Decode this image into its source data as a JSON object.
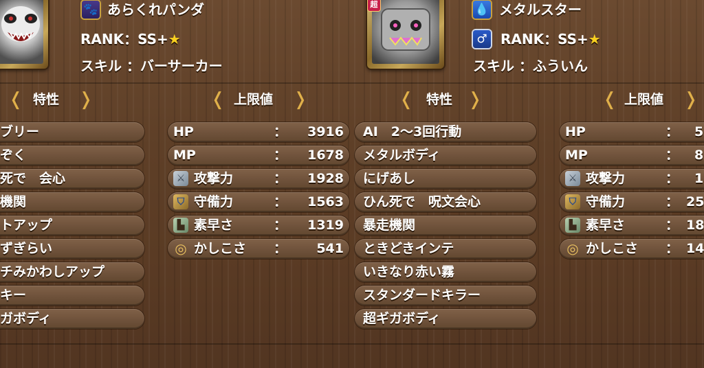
{
  "left_monster": {
    "name": "あらくれパンダ",
    "family_icon": "paw-icon",
    "rank_label": "RANK：SS+",
    "rank_star": "★",
    "skill_line": "スキル ：バーサーカー",
    "traits_header": "特性",
    "traits": [
      "ブリー",
      "ぞく",
      "死で　会心",
      "機関",
      "トアップ",
      "ずぎらい",
      "チみかわしアップ",
      "キー",
      "ガボディ"
    ],
    "stats_header": "上限値",
    "stats": [
      {
        "label": "HP",
        "sep": "：",
        "value": "3916",
        "icon": ""
      },
      {
        "label": "MP",
        "sep": "：",
        "value": "1678",
        "icon": ""
      },
      {
        "label": "攻撃力",
        "sep": "：",
        "value": "1928",
        "icon": "sword-icon"
      },
      {
        "label": "守備力",
        "sep": "：",
        "value": "1563",
        "icon": "shield-icon"
      },
      {
        "label": "素早さ",
        "sep": "：",
        "value": "1319",
        "icon": "boot-icon"
      },
      {
        "label": "かしこさ",
        "sep": "：",
        "value": "541",
        "icon": "ring-icon"
      }
    ]
  },
  "right_monster": {
    "super_badge": "超",
    "name": "メタルスター",
    "family_icon": "slime-icon",
    "rank_label": "RANK：SS+",
    "rank_star": "★",
    "rank_icon": "gender-icon",
    "skill_line": "スキル ：ふういん",
    "traits_header": "特性",
    "traits": [
      "AI　2～3回行動",
      "メタルボディ",
      "にげあし",
      "ひん死で　呪文会心",
      "暴走機関",
      "ときどきインテ",
      "いきなり赤い霧",
      "スタンダードキラー",
      "超ギガボディ"
    ],
    "stats_header": "上限値",
    "stats": [
      {
        "label": "HP",
        "sep": "：",
        "value": "5",
        "icon": ""
      },
      {
        "label": "MP",
        "sep": "：",
        "value": "8",
        "icon": ""
      },
      {
        "label": "攻撃力",
        "sep": "：",
        "value": "1",
        "icon": "sword-icon"
      },
      {
        "label": "守備力",
        "sep": "：",
        "value": "25",
        "icon": "shield-icon"
      },
      {
        "label": "素早さ",
        "sep": "：",
        "value": "18",
        "icon": "boot-icon"
      },
      {
        "label": "かしこさ",
        "sep": "：",
        "value": "14",
        "icon": "ring-icon"
      }
    ]
  }
}
